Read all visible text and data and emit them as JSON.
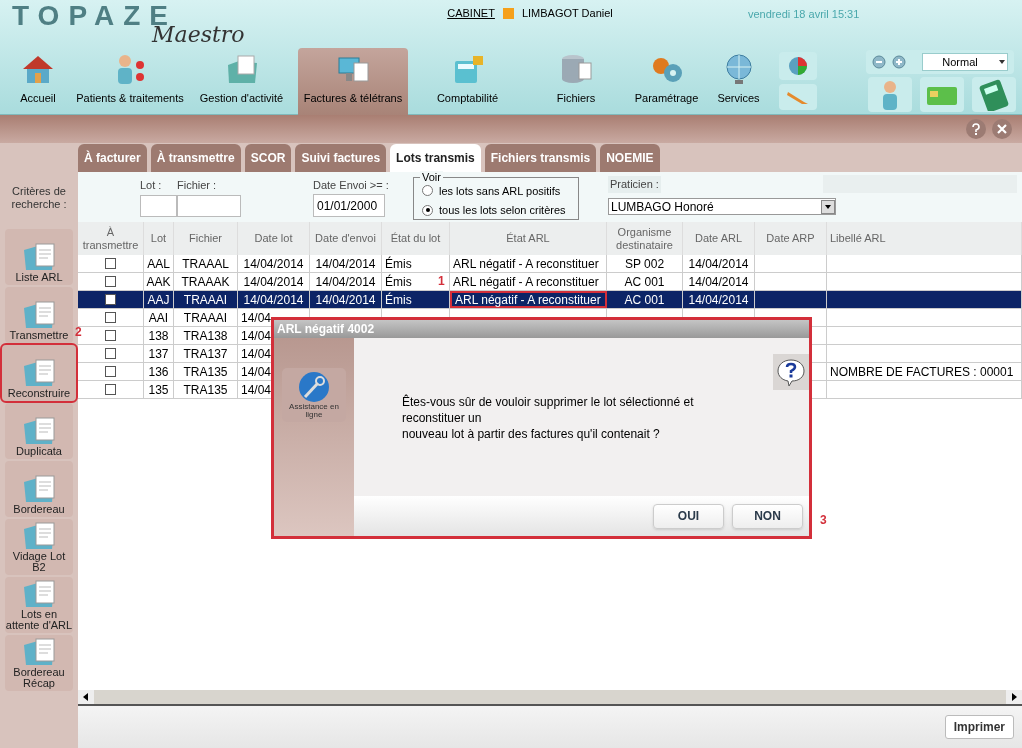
{
  "header": {
    "logo_title": "TOPAZE",
    "logo_subtitle": "Maestro",
    "cabinet_link": "CABINET",
    "user": {
      "name": "LIMBAGOT Daniel",
      "color": "#f5a01a"
    },
    "datetime": "vendredi 18 avril 15:31"
  },
  "nav": [
    {
      "label": "Accueil",
      "selected": false
    },
    {
      "label": "Patients & traitements",
      "selected": false
    },
    {
      "label": "Gestion d'activité",
      "selected": false
    },
    {
      "label": "Factures & télétrans",
      "selected": true
    },
    {
      "label": "Comptabilité",
      "selected": false
    },
    {
      "label": "Fichiers",
      "selected": false
    },
    {
      "label": "Paramétrage",
      "selected": false
    },
    {
      "label": "Services",
      "selected": false
    }
  ],
  "zoom_select": {
    "value": "Normal"
  },
  "tabs": [
    {
      "label": "À facturer",
      "selected": false
    },
    {
      "label": "À transmettre",
      "selected": false
    },
    {
      "label": "SCOR",
      "selected": false
    },
    {
      "label": "Suivi factures",
      "selected": false
    },
    {
      "label": "Lots transmis",
      "selected": true
    },
    {
      "label": "Fichiers transmis",
      "selected": false
    },
    {
      "label": "NOEMIE",
      "selected": false
    }
  ],
  "sidebar": {
    "heading": "Critères de recherche :",
    "items": [
      {
        "label": "Liste ARL",
        "outlined": false
      },
      {
        "label": "Transmettre",
        "outlined": false
      },
      {
        "label": "Reconstruire",
        "outlined": true
      },
      {
        "label": "Duplicata",
        "outlined": false
      },
      {
        "label": "Bordereau",
        "outlined": false
      },
      {
        "label": "Vidage Lot B2",
        "outlined": false
      },
      {
        "label": "Lots en attente d'ARL",
        "outlined": false
      },
      {
        "label": "Bordereau Récap",
        "outlined": false
      }
    ]
  },
  "filters": {
    "lot_label": "Lot :",
    "fichier_label": "Fichier :",
    "date_label": "Date Envoi >= :",
    "date_value": "01/01/2000",
    "voir": {
      "legend": "Voir",
      "options": [
        {
          "label": "les lots sans ARL positifs",
          "selected": false
        },
        {
          "label": "tous les lots selon critères",
          "selected": true
        }
      ]
    },
    "praticien_label": "Praticien :",
    "praticien_value": "LUMBAGO Honoré"
  },
  "table": {
    "columns": [
      {
        "label": "À transmettre",
        "kind": "checkbox"
      },
      {
        "label": "Lot",
        "kind": "text"
      },
      {
        "label": "Fichier",
        "kind": "text"
      },
      {
        "label": "Date lot",
        "kind": "text"
      },
      {
        "label": "Date d'envoi",
        "kind": "text"
      },
      {
        "label": "État du lot",
        "kind": "text"
      },
      {
        "label": "État ARL",
        "kind": "status"
      },
      {
        "label": "Organisme destinataire",
        "kind": "text"
      },
      {
        "label": "Date ARL",
        "kind": "text"
      },
      {
        "label": "Date ARP",
        "kind": "text"
      },
      {
        "label": "Libellé ARL",
        "kind": "text"
      }
    ],
    "rows": [
      {
        "checked": false,
        "selected": false,
        "outlined": false,
        "cells": [
          null,
          "AAL",
          "TRAAAL",
          "14/04/2014",
          "14/04/2014",
          "Émis",
          "ARL négatif - A reconstituer",
          "SP 002",
          "14/04/2014",
          null,
          null
        ]
      },
      {
        "checked": false,
        "selected": false,
        "outlined": false,
        "cells": [
          null,
          "AAK",
          "TRAAAK",
          "14/04/2014",
          "14/04/2014",
          "Émis",
          "ARL négatif - A reconstituer",
          "AC 001",
          "14/04/2014",
          null,
          null
        ]
      },
      {
        "checked": false,
        "selected": true,
        "outlined": true,
        "cells": [
          null,
          "AAJ",
          "TRAAAI",
          "14/04/2014",
          "14/04/2014",
          "Émis",
          "ARL négatif - A reconstituer",
          "AC 001",
          "14/04/2014",
          null,
          null
        ]
      },
      {
        "checked": false,
        "selected": false,
        "cells": [
          null,
          "AAI",
          "TRAAAI",
          "14/04",
          null,
          null,
          null,
          null,
          null,
          null,
          null
        ]
      },
      {
        "checked": false,
        "selected": false,
        "cells": [
          null,
          "138",
          "TRA138",
          "14/04",
          null,
          null,
          null,
          null,
          null,
          null,
          null
        ]
      },
      {
        "checked": false,
        "selected": false,
        "cells": [
          null,
          "137",
          "TRA137",
          "14/04",
          null,
          null,
          null,
          null,
          null,
          null,
          null
        ]
      },
      {
        "checked": false,
        "selected": false,
        "cells": [
          null,
          "136",
          "TRA135",
          "14/04",
          null,
          null,
          null,
          null,
          null,
          null,
          "NOMBRE DE FACTURES : 00001"
        ]
      },
      {
        "checked": false,
        "selected": false,
        "cells": [
          null,
          "135",
          "TRA135",
          "14/04",
          null,
          null,
          null,
          null,
          null,
          null,
          null
        ]
      }
    ]
  },
  "dialog": {
    "title": "ARL négatif 4002",
    "assist_label": "Assistance en ligne",
    "message": "Êtes-vous sûr de vouloir supprimer le lot sélectionné et\nreconstituer un\nnouveau lot à partir des factures qu'il contenait ?",
    "buttons": [
      "OUI",
      "NON"
    ],
    "outlined": true
  },
  "annotations": [
    "1",
    "2",
    "3"
  ],
  "print_button": "Imprimer"
}
